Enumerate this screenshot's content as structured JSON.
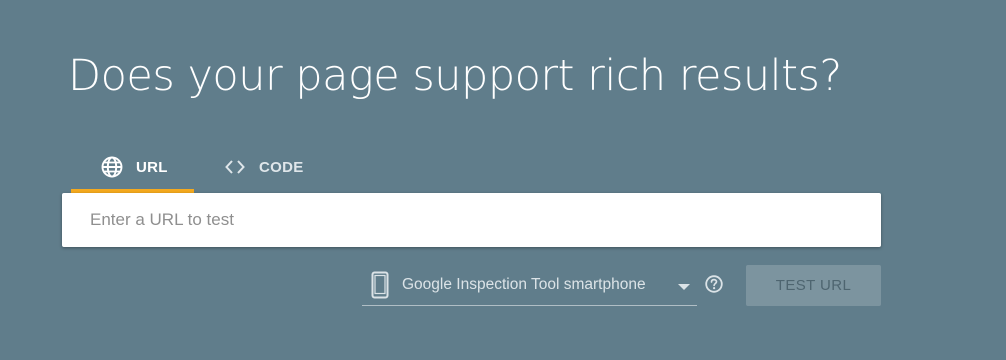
{
  "page": {
    "title": "Does your page support rich results?"
  },
  "tabs": [
    {
      "label": "URL",
      "icon": "globe-icon",
      "active": true
    },
    {
      "label": "CODE",
      "icon": "code-brackets-icon",
      "active": false
    }
  ],
  "url_input": {
    "placeholder": "Enter a URL to test",
    "value": ""
  },
  "device_select": {
    "icon": "smartphone-icon",
    "selected": "Google Inspection Tool smartphone"
  },
  "help": {
    "icon": "help-circle-icon"
  },
  "test_button": {
    "label": "TEST URL",
    "enabled": false
  },
  "colors": {
    "background": "#607d8b",
    "active_tab_indicator": "#f4a91e",
    "input_background": "#ffffff",
    "button_disabled_bg": "#7c949f"
  }
}
